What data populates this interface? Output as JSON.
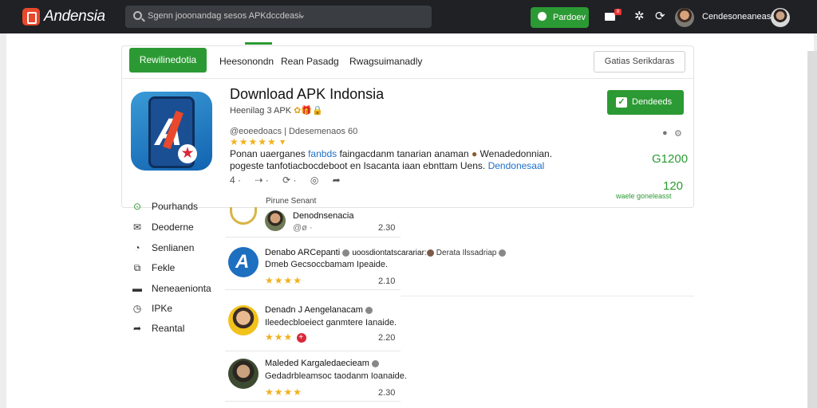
{
  "topbar": {
    "brand": "Andensia",
    "search_placeholder": "Sgenn jooonandag sesos APKdccdeasi.",
    "action_button": "Pardoev",
    "mail_badge": "8",
    "user_name": "Cendesoneaneas"
  },
  "tabs": {
    "primary": "Rewilinedotia",
    "items": [
      "Heesonondn",
      "Rean Pasadg",
      "Rwagsuimanadly"
    ],
    "outline": "Gatias Serikdaras"
  },
  "app": {
    "title": "Download APK Indonsia",
    "subtitle": "Heenilag 3 APK",
    "meta": "@eoeedoacs | Ddesemenaos 60",
    "rating_stars": "★★★★★ ▾",
    "desc_line1": "Ponan uaerganes",
    "desc_link1": "fanbds",
    "desc_line1b": "faingacdanm tanarian anaman",
    "desc_line1c": "Wenadedonnian.",
    "desc_line2": "pogeste tanfotiacbocdeboot en Isacanta iaan ebnttam Uens.",
    "desc_link2": "Dendonesaal",
    "actions": [
      "4 ·",
      "⇢ ·",
      "⟳ ·",
      "◎",
      "➦"
    ],
    "download_button": "Dendeeds",
    "price_main": "G1200",
    "price_secondary": "120",
    "price_label": "waele goneleasst"
  },
  "sidebar": {
    "items": [
      {
        "icon": "⊙",
        "label": "Pourhands"
      },
      {
        "icon": "✉",
        "label": "Deoderne"
      },
      {
        "icon": "◔",
        "label": "Senlianen"
      },
      {
        "icon": "⧉",
        "label": "Fekle"
      },
      {
        "icon": "▬",
        "label": "Neneaenionta"
      },
      {
        "icon": "◷",
        "label": "IPKe"
      },
      {
        "icon": "➦",
        "label": "Reantal"
      }
    ]
  },
  "reviews_section": {
    "label": "Pirune Senant",
    "reviews": [
      {
        "name": "Denodnsenacia",
        "text": "@ø ·",
        "stars": "",
        "num": "2.30"
      },
      {
        "name": "Denabo ARCepanti",
        "name_suffix": "uoosdiontatscarariar:",
        "text": "Dmeb Gecsoccbamam Ipeaide.",
        "extra": "Derata Ilssadriap",
        "stars": "★★★★",
        "num": "2.10"
      },
      {
        "name": "Denadn J Aengelanacam",
        "text": "Ileedecbloeiect ganmtere Ianaide.",
        "stars": "★★★",
        "num": "2.20"
      },
      {
        "name": "Maleded Kargaledaecieam",
        "text": "Gedadrbleamsoc taodanm Ioanaide.",
        "stars": "★★★★",
        "num": "2.30"
      }
    ]
  }
}
